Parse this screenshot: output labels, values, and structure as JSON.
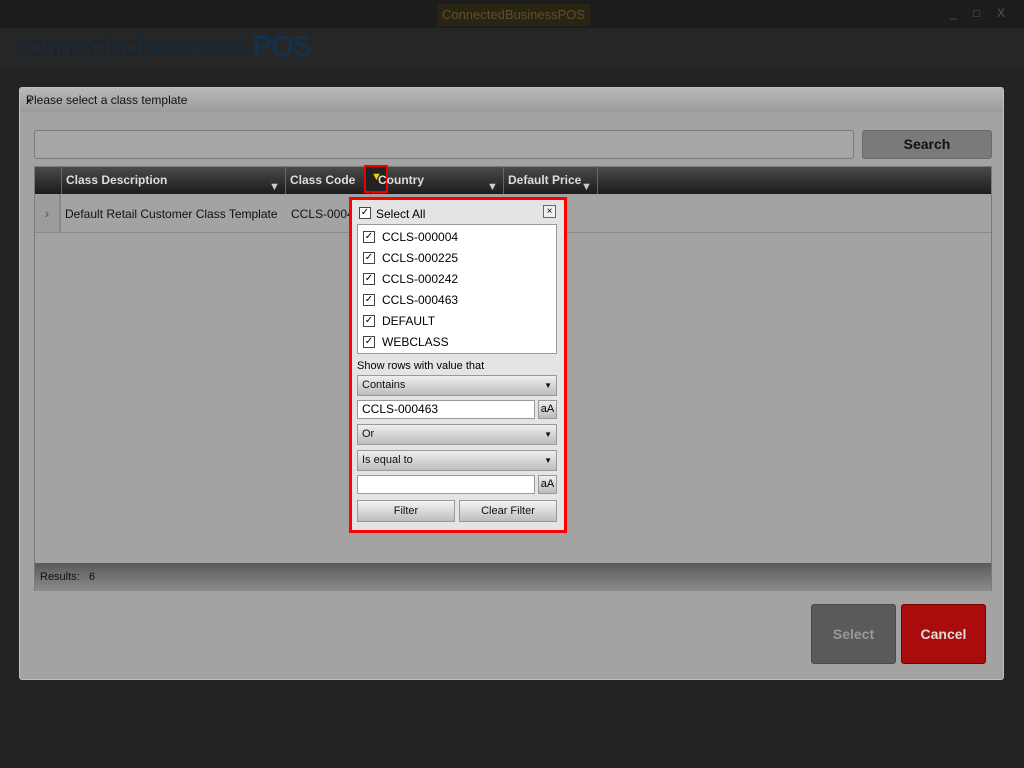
{
  "window": {
    "title": "ConnectedBusinessPOS",
    "minimize": "_",
    "maximize": "□",
    "close": "X"
  },
  "logo": {
    "part1": "connected",
    "part2": "business",
    "part3": "POS"
  },
  "dialog": {
    "title": "Please select a class template",
    "close": "x",
    "search": {
      "value": "",
      "button": "Search"
    },
    "grid": {
      "columns": [
        "Class Description",
        "Class Code",
        "Country",
        "Default Price"
      ],
      "rows": [
        {
          "description": "Default Retail Customer Class Template",
          "code": "CCLS-00046"
        }
      ],
      "footer_label": "Results:",
      "footer_count": "6"
    },
    "buttons": {
      "select": "Select",
      "cancel": "Cancel"
    }
  },
  "filter_popup": {
    "select_all": "Select All",
    "close": "×",
    "items": [
      "CCLS-000004",
      "CCLS-000225",
      "CCLS-000242",
      "CCLS-000463",
      "DEFAULT",
      "WEBCLASS"
    ],
    "show_rows_label": "Show rows with value that",
    "operator1": "Contains",
    "value1": "CCLS-000463",
    "case_label": "aA",
    "logic": "Or",
    "operator2": "Is equal to",
    "value2": "",
    "filter_button": "Filter",
    "clear_button": "Clear Filter"
  },
  "colors": {
    "accent_red": "#a80c0c",
    "highlight": "#ff0000"
  }
}
